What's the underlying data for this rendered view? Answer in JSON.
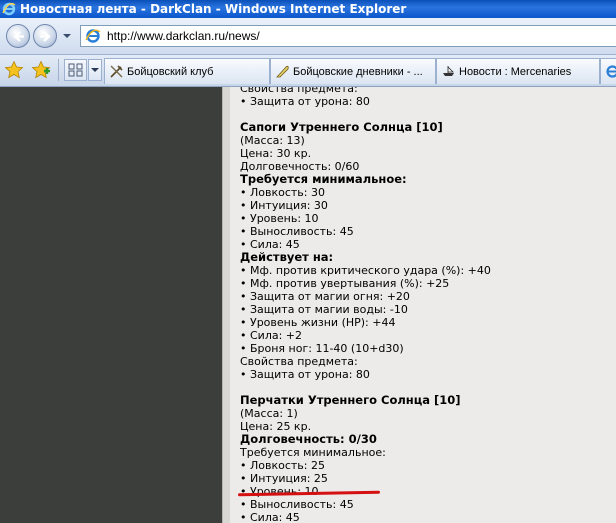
{
  "window": {
    "title": "Новостная лента - DarkClan - Windows Internet Explorer"
  },
  "address_bar": {
    "url": "http://www.darkclan.ru/news/"
  },
  "tabs": [
    {
      "label": "Бойцовский клуб",
      "icon": "sword-icon"
    },
    {
      "label": "Бойцовские дневники - ...",
      "icon": "quill-icon"
    },
    {
      "label": "Новости : Mercenaries",
      "icon": "ship-icon"
    }
  ],
  "content": {
    "lines": [
      {
        "text": "Свойства предмета:",
        "style": "normal"
      },
      {
        "text": "• Защита от урона: 80",
        "style": "normal"
      },
      {
        "text": "",
        "style": "gap"
      },
      {
        "text": "Сапоги Утреннего Солнца [10]",
        "style": "bold"
      },
      {
        "text": "(Масса: 13)",
        "style": "normal"
      },
      {
        "text": "Цена: 30 кр.",
        "style": "normal"
      },
      {
        "text": "Долговечность: 0/60",
        "style": "normal"
      },
      {
        "text": "Требуется минимальное:",
        "style": "bold"
      },
      {
        "text": "• Ловкость: 30",
        "style": "normal"
      },
      {
        "text": "• Интуиция: 30",
        "style": "normal"
      },
      {
        "text": "• Уровень: 10",
        "style": "normal"
      },
      {
        "text": "• Выносливость: 45",
        "style": "normal"
      },
      {
        "text": "• Сила: 45",
        "style": "normal"
      },
      {
        "text": "Действует на:",
        "style": "bold"
      },
      {
        "text": "• Мф. против критического удара (%): +40",
        "style": "normal"
      },
      {
        "text": "• Мф. против увертывания (%): +25",
        "style": "normal"
      },
      {
        "text": "• Защита от магии огня: +20",
        "style": "normal"
      },
      {
        "text": "• Защита от магии воды: -10",
        "style": "normal"
      },
      {
        "text": "• Уровень жизни (HP): +44",
        "style": "normal"
      },
      {
        "text": "• Сила: +2",
        "style": "normal"
      },
      {
        "text": "• Броня ног: 11-40 (10+d30)",
        "style": "normal"
      },
      {
        "text": "Свойства предмета:",
        "style": "normal"
      },
      {
        "text": "• Защита от урона: 80",
        "style": "normal"
      },
      {
        "text": "",
        "style": "gap"
      },
      {
        "text": "Перчатки Утреннего Солнца [10]",
        "style": "bold"
      },
      {
        "text": "(Масса: 1)",
        "style": "normal"
      },
      {
        "text": "Цена: 25 кр.",
        "style": "normal"
      },
      {
        "text": "Долговечность: 0/30",
        "style": "bold"
      },
      {
        "text": "Требуется минимальное:",
        "style": "normal"
      },
      {
        "text": "• Ловкость: 25",
        "style": "normal"
      },
      {
        "text": "• Интуиция: 25",
        "style": "normal"
      },
      {
        "text": "• Уровень: 10",
        "style": "normal"
      },
      {
        "text": "• Выносливость: 45",
        "style": "normal"
      },
      {
        "text": "• Сила: 45",
        "style": "normal"
      }
    ]
  }
}
